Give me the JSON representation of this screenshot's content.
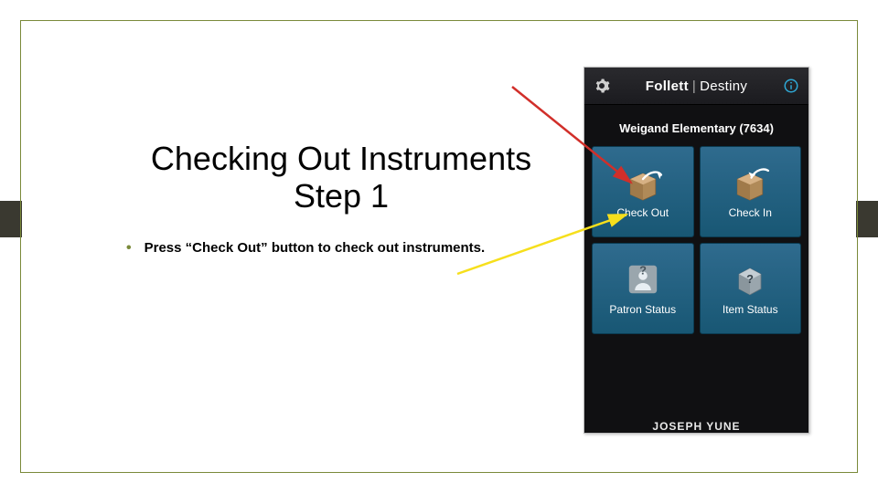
{
  "title_line1": "Checking Out Instruments",
  "title_line2": "Step 1",
  "bullet_text": "Press “Check Out” button to check out instruments.",
  "phone": {
    "brand_main": "Follett",
    "brand_sub": "Destiny",
    "school": "Weigand Elementary (7634)",
    "tiles": {
      "check_out": "Check Out",
      "check_in": "Check In",
      "patron_status": "Patron Status",
      "item_status": "Item Status"
    },
    "user": "JOSEPH YUNE"
  }
}
